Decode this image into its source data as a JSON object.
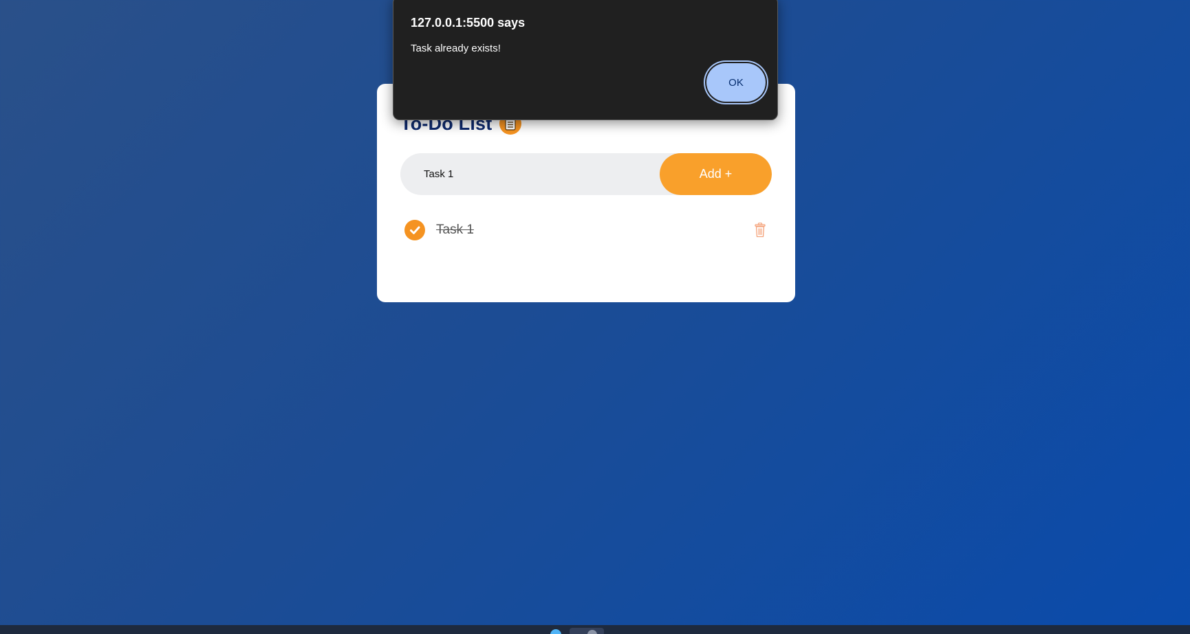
{
  "todo": {
    "title": "To-Do List",
    "title_icon": "checklist-icon",
    "input": {
      "value": "Task 1",
      "placeholder": ""
    },
    "add_label": "Add +",
    "tasks": [
      {
        "text": "Task 1",
        "completed": true
      }
    ]
  },
  "alert": {
    "title": "127.0.0.1:5500 says",
    "message": "Task already exists!",
    "ok_label": "OK"
  },
  "colors": {
    "accent": "#f9a02b",
    "title": "#0e2a6e",
    "background": "#1c4c94",
    "alert_button": "#a8c7fa"
  }
}
